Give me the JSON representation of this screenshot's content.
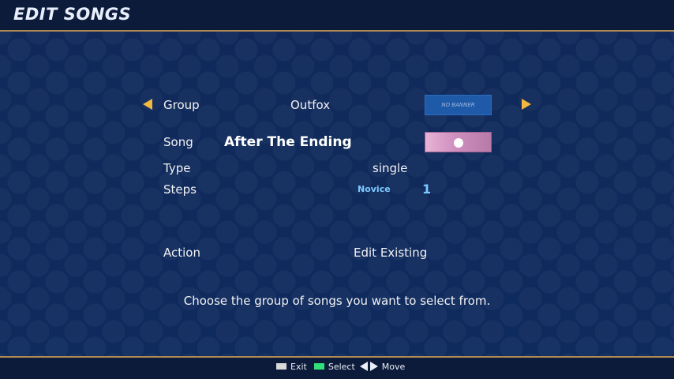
{
  "header": {
    "title": "EDIT SONGS"
  },
  "rows": {
    "group": {
      "label": "Group",
      "value": "Outfox",
      "banner_text": "NO BANNER"
    },
    "song": {
      "label": "Song",
      "value": "After The Ending"
    },
    "type": {
      "label": "Type",
      "value": "single"
    },
    "steps": {
      "label": "Steps",
      "difficulty": "Novice",
      "meter": "1"
    },
    "action": {
      "label": "Action",
      "value": "Edit Existing"
    }
  },
  "help_text": "Choose the group of songs you want to select from.",
  "footer": {
    "exit_label": "Exit",
    "select_label": "Select",
    "move_label": "Move"
  },
  "colors": {
    "accent_arrow": "#f1b93e",
    "difficulty": "#7ec8ff",
    "exit_swatch": "#d9d9d9",
    "select_swatch": "#31e07a"
  }
}
